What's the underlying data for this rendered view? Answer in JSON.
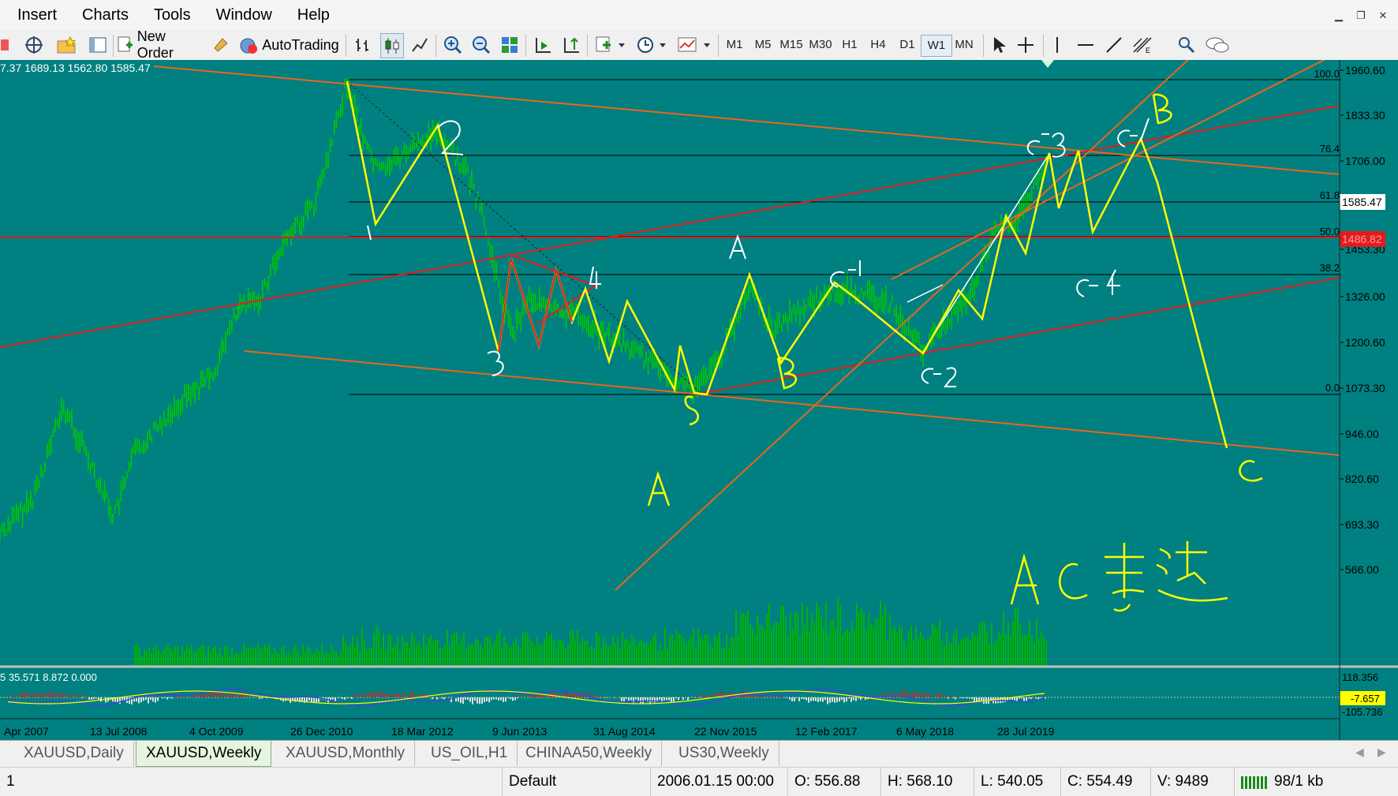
{
  "menu": [
    "Insert",
    "Charts",
    "Tools",
    "Window",
    "Help"
  ],
  "toolbar": {
    "new_order": "New Order",
    "autotrading": "AutoTrading",
    "timeframes": [
      "M1",
      "M5",
      "M15",
      "M30",
      "H1",
      "H4",
      "D1",
      "W1",
      "MN"
    ],
    "active_timeframe": "W1"
  },
  "chart": {
    "ohlc_text": "7.37 1689.13 1562.80 1585.47",
    "price_labels": [
      "1960.60",
      "1833.30",
      "1706.00",
      "1585.47",
      "1453.30",
      "1326.00",
      "1200.60",
      "1073.30",
      "946.00",
      "820.60",
      "693.30",
      "566.00"
    ],
    "current_price": "1585.47",
    "red_line_price": "1486.82",
    "fib_levels": [
      "100.0",
      "76.4",
      "61.8",
      "50.0",
      "38.2",
      "0.0"
    ],
    "date_labels": [
      "Apr 2007",
      "13 Jul 2008",
      "4 Oct 2009",
      "26 Dec 2010",
      "18 Mar 2012",
      "9 Jun 2013",
      "31 Aug 2014",
      "22 Nov 2015",
      "12 Feb 2017",
      "6 May 2018",
      "28 Jul 2019"
    ],
    "indicator_text": "5 35.571 8.872 0.000",
    "indicator_labels": [
      "118.356",
      "-7.657",
      "-105.736"
    ],
    "annotations": {
      "w1": "1",
      "w2": "2",
      "w3": "3",
      "w4": "4",
      "w5": "A 5",
      "a": "A",
      "b": "B",
      "c1": "C-1",
      "c2": "C-2",
      "c3": "C-3",
      "c4": "C-4",
      "c5": "C-5",
      "bigB": "B",
      "bigC": "C",
      "note": "A C等距"
    }
  },
  "tabs": [
    "XAUUSD,Daily",
    "XAUUSD,Weekly",
    "XAUUSD,Monthly",
    "US_OIL,H1",
    "CHINAA50,Weekly",
    "US30,Weekly"
  ],
  "active_tab": "XAUUSD,Weekly",
  "status": {
    "left": "1",
    "profile": "Default",
    "datetime": "2006.01.15 00:00",
    "open": "O: 556.88",
    "high": "H: 568.10",
    "low": "L: 540.05",
    "close": "C: 554.49",
    "volume": "V: 9489",
    "traffic": "98/1 kb"
  },
  "colors": {
    "chart_bg": "#008080",
    "candles": "#00c800",
    "wave_line": "#ffff00",
    "trend_red": "#e21c1c",
    "trend_orange": "#e8661a",
    "annotation": "#ffffff"
  }
}
